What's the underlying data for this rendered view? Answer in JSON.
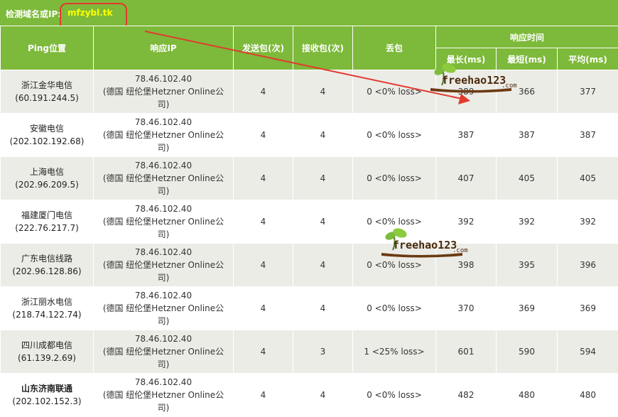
{
  "header": {
    "label": "检测域名或IP:",
    "domain": "mfzybl.tk"
  },
  "columns": {
    "location": "Ping位置",
    "ip": "响应IP",
    "sent": "发送包(次)",
    "received": "接收包(次)",
    "loss": "丢包",
    "response_time": "响应时间",
    "max": "最长(ms)",
    "min": "最短(ms)",
    "avg": "平均(ms)"
  },
  "rows": [
    {
      "loc": "浙江金华电信",
      "loc_ip": "(60.191.244.5)",
      "ip": "78.46.102.40",
      "ip_info": "(德国 纽伦堡Hetzner Online公",
      "ip_info2": "司)",
      "sent": "4",
      "received": "4",
      "loss": "0 <0% loss>",
      "max": "389",
      "min": "366",
      "avg": "377"
    },
    {
      "loc": "安徽电信",
      "loc_ip": "(202.102.192.68)",
      "ip": "78.46.102.40",
      "ip_info": "(德国 纽伦堡Hetzner Online公",
      "ip_info2": "司)",
      "sent": "4",
      "received": "4",
      "loss": "0 <0% loss>",
      "max": "387",
      "min": "387",
      "avg": "387"
    },
    {
      "loc": "上海电信",
      "loc_ip": "(202.96.209.5)",
      "ip": "78.46.102.40",
      "ip_info": "(德国 纽伦堡Hetzner Online公",
      "ip_info2": "司)",
      "sent": "4",
      "received": "4",
      "loss": "0 <0% loss>",
      "max": "407",
      "min": "405",
      "avg": "405"
    },
    {
      "loc": "福建厦门电信",
      "loc_ip": "(222.76.217.7)",
      "ip": "78.46.102.40",
      "ip_info": "(德国 纽伦堡Hetzner Online公",
      "ip_info2": "司)",
      "sent": "4",
      "received": "4",
      "loss": "0 <0% loss>",
      "max": "392",
      "min": "392",
      "avg": "392"
    },
    {
      "loc": "广东电信线路",
      "loc_ip": "(202.96.128.86)",
      "ip": "78.46.102.40",
      "ip_info": "(德国 纽伦堡Hetzner Online公",
      "ip_info2": "司)",
      "sent": "4",
      "received": "4",
      "loss": "0 <0% loss>",
      "max": "398",
      "min": "395",
      "avg": "396"
    },
    {
      "loc": "浙江丽水电信",
      "loc_ip": "(218.74.122.74)",
      "ip": "78.46.102.40",
      "ip_info": "(德国 纽伦堡Hetzner Online公",
      "ip_info2": "司)",
      "sent": "4",
      "received": "4",
      "loss": "0 <0% loss>",
      "max": "370",
      "min": "369",
      "avg": "369"
    },
    {
      "loc": "四川成都电信",
      "loc_ip": "(61.139.2.69)",
      "ip": "78.46.102.40",
      "ip_info": "(德国 纽伦堡Hetzner Online公",
      "ip_info2": "司)",
      "sent": "4",
      "received": "3",
      "loss": "1 <25% loss>",
      "max": "601",
      "min": "590",
      "avg": "594"
    },
    {
      "loc": "山东济南联通",
      "loc_ip": "(202.102.152.3)",
      "ip": "78.46.102.40",
      "ip_info": "(德国 纽伦堡Hetzner Online公",
      "ip_info2": "司)",
      "sent": "4",
      "received": "4",
      "loss": "0 <0% loss>",
      "max": "482",
      "min": "480",
      "avg": "480",
      "bold": true
    }
  ],
  "watermark": {
    "text": "freehao123",
    "suffix": ".com"
  },
  "colors": {
    "header_green": "#7db93a",
    "domain_yellow": "#ffff00",
    "annotation_red": "#e23a2f",
    "row_alt": "#ecece7"
  }
}
